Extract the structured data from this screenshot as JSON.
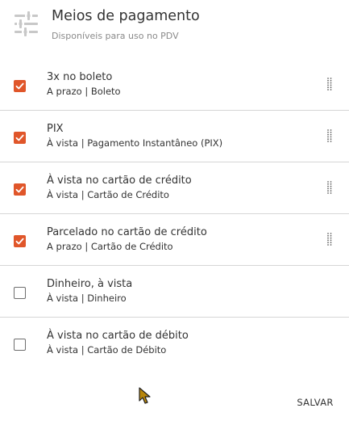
{
  "header": {
    "title": "Meios de pagamento",
    "subtitle": "Disponíveis para uso no PDV",
    "icon": "sliders-icon"
  },
  "payment_methods": [
    {
      "title": "3x no boleto",
      "subtitle": "A prazo | Boleto",
      "checked": true,
      "draggable": true
    },
    {
      "title": "PIX",
      "subtitle": "À vista | Pagamento Instantâneo (PIX)",
      "checked": true,
      "draggable": true
    },
    {
      "title": "À vista no cartão de crédito",
      "subtitle": "À vista | Cartão de Crédito",
      "checked": true,
      "draggable": true
    },
    {
      "title": "Parcelado no cartão de crédito",
      "subtitle": "A prazo | Cartão de Crédito",
      "checked": true,
      "draggable": true
    },
    {
      "title": "Dinheiro, à vista",
      "subtitle": "À vista | Dinheiro",
      "checked": false,
      "draggable": false
    },
    {
      "title": "À vista no cartão de débito",
      "subtitle": "À vista | Cartão de Débito",
      "checked": false,
      "draggable": false
    }
  ],
  "actions": {
    "save_label": "SALVAR"
  },
  "colors": {
    "accent": "#e0562a",
    "divider": "#d6d6d6",
    "muted_text": "#8a8a8a"
  }
}
